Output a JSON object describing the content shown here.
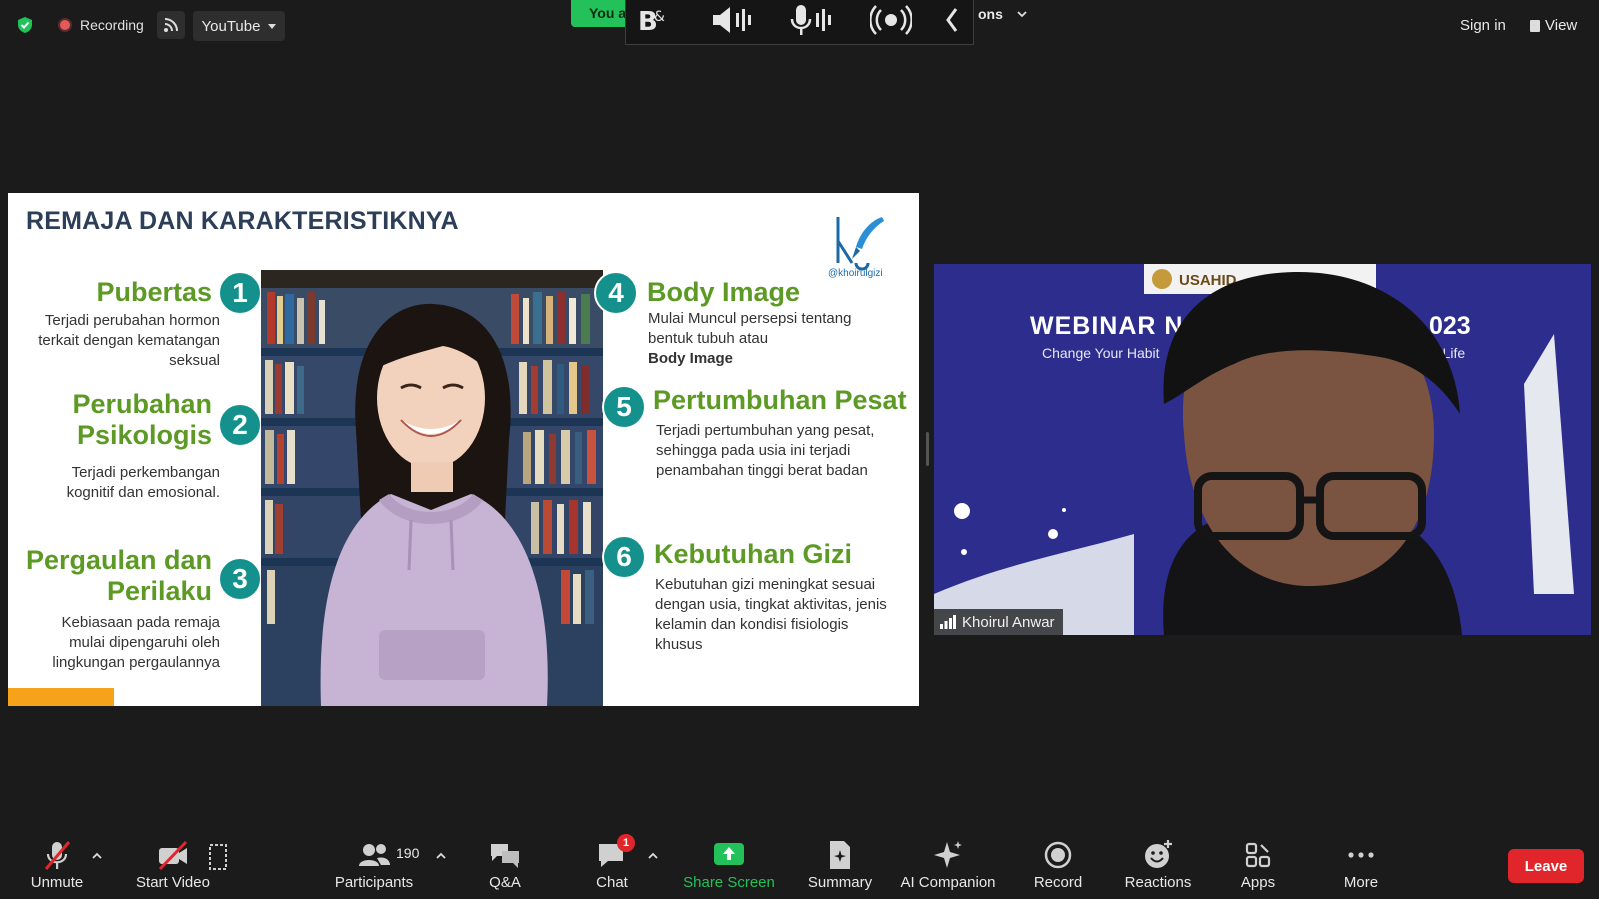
{
  "topbar": {
    "recording_label": "Recording",
    "stream_label": "YouTube",
    "you_label": "You a",
    "options_fragment": "ons",
    "sign_in": "Sign in",
    "view": "View"
  },
  "slide": {
    "title": "REMAJA DAN KARAKTERISTIKNYA",
    "logo_handle": "@khoirulgizi",
    "items": [
      {
        "num": "1",
        "title": "Pubertas",
        "text": "Terjadi perubahan hormon terkait dengan kematangan seksual"
      },
      {
        "num": "2",
        "title_line1": "Perubahan",
        "title_line2": "Psikologis",
        "text": "Terjadi perkembangan kognitif dan emosional."
      },
      {
        "num": "3",
        "title_line1": "Pergaulan dan",
        "title_line2": "Perilaku",
        "text": "Kebiasaan pada remaja mulai dipengaruhi oleh lingkungan pergaulannya"
      },
      {
        "num": "4",
        "title": "Body Image",
        "text": "Mulai Muncul persepsi tentang bentuk tubuh atau",
        "text_bold": "Body Image"
      },
      {
        "num": "5",
        "title": "Pertumbuhan Pesat",
        "text": "Terjadi pertumbuhan yang pesat, sehingga pada usia ini terjadi penambahan tinggi berat badan"
      },
      {
        "num": "6",
        "title": "Kebutuhan Gizi",
        "text": "Kebutuhan gizi meningkat sesuai dengan usia, tingkat aktivitas, jenis kelamin dan kondisi fisiologis khusus"
      }
    ]
  },
  "video": {
    "participant_name": "Khoirul Anwar",
    "backdrop_logo": "USAHID",
    "backdrop_title_left": "WEBINAR N",
    "backdrop_title_right": "023",
    "backdrop_sub_left": "Change Your Habit",
    "backdrop_sub_right": "r Life"
  },
  "toolbar": {
    "unmute": "Unmute",
    "start_video": "Start Video",
    "participants": "Participants",
    "participants_count": "190",
    "qa": "Q&A",
    "chat": "Chat",
    "chat_badge": "1",
    "share_screen": "Share Screen",
    "summary": "Summary",
    "ai_companion": "AI Companion",
    "record": "Record",
    "reactions": "Reactions",
    "apps": "Apps",
    "more": "More",
    "leave": "Leave"
  },
  "colors": {
    "share_green": "#23c15a",
    "leave_red": "#e0262b",
    "slide_green": "#5c9a25",
    "slide_teal": "#14918c",
    "slide_navy": "#2d3f58"
  }
}
